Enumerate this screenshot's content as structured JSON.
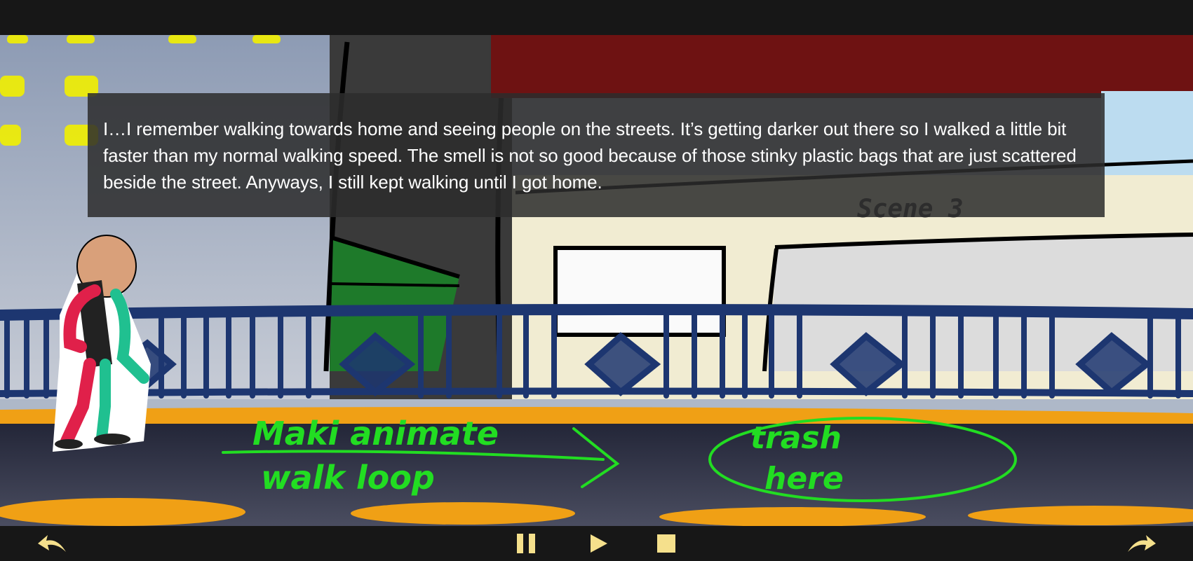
{
  "narration": {
    "text": "I…I remember walking towards home and seeing people on the streets. It’s getting darker out there so I walked a little bit faster than my normal walking speed. The smell is not so good because of those stinky plastic bags that are just scattered beside the street. Anyways, I still kept walking until I got home."
  },
  "scene": {
    "sign_label": "Scene 3",
    "note_walk_line1": "Maki animate",
    "note_walk_line2": "walk loop",
    "note_trash_line1": "trash",
    "note_trash_line2": "here"
  },
  "controls": {
    "back_icon": "curved-arrow-left-icon",
    "pause_icon": "pause-icon",
    "play_icon": "play-icon",
    "stop_icon": "stop-icon",
    "forward_icon": "curved-arrow-right-icon",
    "icon_color": "#f5e08c"
  },
  "colors": {
    "railing": "#1d3670",
    "sketch_green": "#22dd22",
    "curb_orange": "#f0a015",
    "road": "#2a2d3e"
  }
}
